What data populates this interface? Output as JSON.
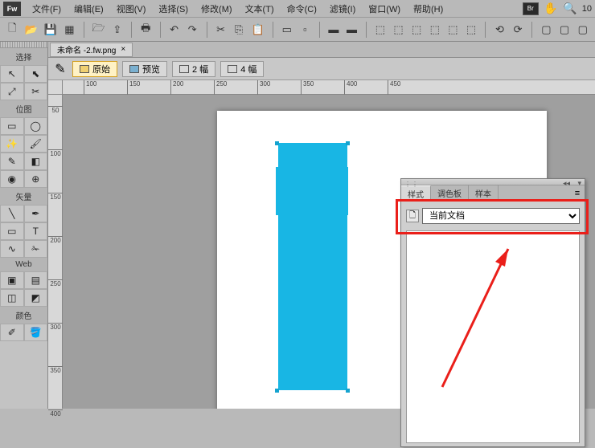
{
  "app": {
    "logo": "Fw"
  },
  "menu": {
    "file": "文件(F)",
    "edit": "编辑(E)",
    "view": "视图(V)",
    "select": "选择(S)",
    "modify": "修改(M)",
    "text": "文本(T)",
    "commands": "命令(C)",
    "filters": "滤镜(I)",
    "window": "窗口(W)",
    "help": "帮助(H)",
    "br": "Br",
    "zoom_value": "10"
  },
  "tabs": {
    "doc1": "未命名 -2.fw.png"
  },
  "viewbar": {
    "original": "原始",
    "preview": "预览",
    "two_up": "2 幅",
    "four_up": "4 幅"
  },
  "ruler_h": [
    "100",
    "150",
    "200",
    "250",
    "300",
    "350",
    "400",
    "450"
  ],
  "ruler_v": [
    "50",
    "100",
    "150",
    "200",
    "250",
    "300",
    "350",
    "400"
  ],
  "left_tools": {
    "select": "选择",
    "bitmap": "位图",
    "vector": "矢量",
    "web": "Web",
    "colors": "颜色"
  },
  "panel": {
    "styles": "样式",
    "palette": "调色板",
    "swatches": "样本",
    "current_doc": "当前文档"
  }
}
